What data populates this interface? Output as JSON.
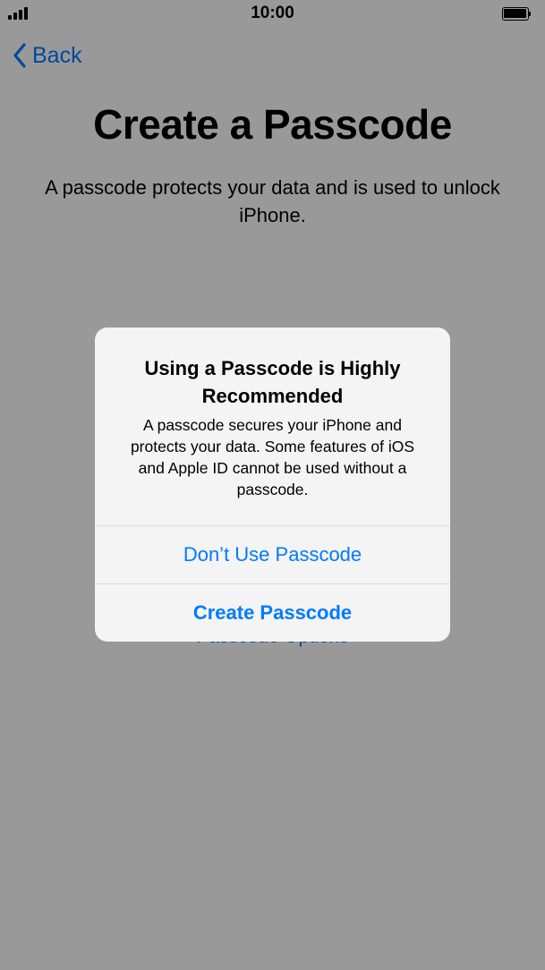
{
  "status_bar": {
    "time": "10:00",
    "signal_icon": "cellular-signal-icon",
    "battery_icon": "battery-icon"
  },
  "nav": {
    "back_label": "Back",
    "back_icon": "chevron-left-icon"
  },
  "page": {
    "title": "Create a Passcode",
    "subtitle": "A passcode protects your data and is used to unlock iPhone.",
    "options_link": "Passcode Options"
  },
  "alert": {
    "title": "Using a Passcode is Highly Recommended",
    "message": "A passcode secures your iPhone and protects your data. Some features of iOS and Apple ID cannot be used without a passcode.",
    "buttons": {
      "dont_use": "Don’t Use Passcode",
      "create": "Create Passcode"
    }
  },
  "colors": {
    "accent": "#007aff",
    "alert_background": "#f4f4f4",
    "dim_overlay": "rgba(0,0,0,0.40)"
  }
}
